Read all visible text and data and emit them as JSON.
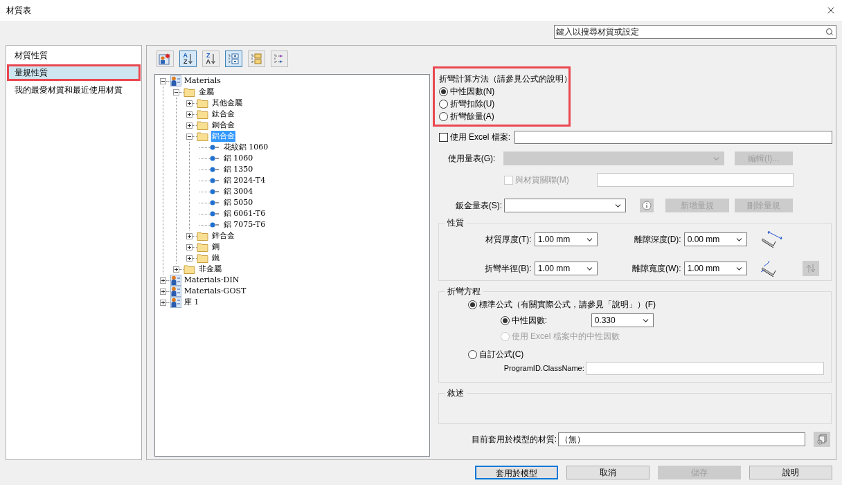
{
  "window": {
    "title": "材質表"
  },
  "search": {
    "placeholder": "鍵入以搜尋材質或設定"
  },
  "nav": {
    "items": [
      {
        "label": "材質性質",
        "selected": false,
        "annotated": false
      },
      {
        "label": "量規性質",
        "selected": true,
        "annotated": true
      },
      {
        "label": "我的最愛材質和最近使用材質",
        "selected": false,
        "annotated": false
      }
    ]
  },
  "toolbar": {
    "buttons": [
      {
        "kind": "new",
        "pressed": false
      },
      {
        "kind": "sort",
        "letters": [
          "A",
          "Z"
        ],
        "pressed": true
      },
      {
        "kind": "sort",
        "letters": [
          "Z",
          "A"
        ],
        "pressed": false
      },
      {
        "kind": "tree",
        "pressed": true
      },
      {
        "kind": "folders",
        "pressed": false
      },
      {
        "kind": "list",
        "pressed": false
      }
    ]
  },
  "tree": [
    {
      "label": "Materials",
      "kind": "library",
      "expanded": true,
      "selected": false,
      "children": [
        {
          "label": "金屬",
          "kind": "folder",
          "expanded": true,
          "selected": false,
          "children": [
            {
              "label": "其他金屬",
              "kind": "folder",
              "expanded": false,
              "selected": false
            },
            {
              "label": "鈦合金",
              "kind": "folder",
              "expanded": false,
              "selected": false
            },
            {
              "label": "銅合金",
              "kind": "folder",
              "expanded": false,
              "selected": false
            },
            {
              "label": "鋁合金",
              "kind": "folder",
              "expanded": true,
              "selected": true,
              "children": [
                {
                  "label": "花紋鋁 1060",
                  "kind": "material",
                  "selected": false
                },
                {
                  "label": "鋁 1060",
                  "kind": "material",
                  "selected": false
                },
                {
                  "label": "鋁 1350",
                  "kind": "material",
                  "selected": false
                },
                {
                  "label": "鋁 2024-T4",
                  "kind": "material",
                  "selected": false
                },
                {
                  "label": "鋁 3004",
                  "kind": "material",
                  "selected": false
                },
                {
                  "label": "鋁 5050",
                  "kind": "material",
                  "selected": false
                },
                {
                  "label": "鋁 6061-T6",
                  "kind": "material",
                  "selected": false
                },
                {
                  "label": "鋁 7075-T6",
                  "kind": "material",
                  "selected": false
                }
              ]
            },
            {
              "label": "鋅合金",
              "kind": "folder",
              "expanded": false,
              "selected": false
            },
            {
              "label": "鋼",
              "kind": "folder",
              "expanded": false,
              "selected": false
            },
            {
              "label": "鐵",
              "kind": "folder",
              "expanded": false,
              "selected": false
            }
          ]
        },
        {
          "label": "非金屬",
          "kind": "folder",
          "expanded": false,
          "selected": false
        }
      ]
    },
    {
      "label": "Materials-DIN",
      "kind": "library",
      "expanded": false,
      "selected": false
    },
    {
      "label": "Materials-GOST",
      "kind": "library",
      "expanded": false,
      "selected": false
    },
    {
      "label": "庫 1",
      "kind": "library",
      "expanded": false,
      "selected": false
    }
  ],
  "bend_method": {
    "title": "折彎計算方法（請參見公式的說明）",
    "annotated": true,
    "options": [
      {
        "label": "中性因數(N)",
        "selected": true
      },
      {
        "label": "折彎扣除(U)",
        "selected": false
      },
      {
        "label": "折彎餘量(A)",
        "selected": false
      }
    ]
  },
  "excel": {
    "label": "使用 Excel 檔案:",
    "checked": false
  },
  "gauge_table": {
    "label": "使用量表(G):",
    "disabled": true,
    "button": {
      "label": "編輯(I)...",
      "disabled": true
    }
  },
  "link_material": {
    "label": "與材質關聯(M)",
    "checked": false,
    "disabled": true
  },
  "sheet_gauge": {
    "label": "鈑金量表(S):",
    "buttons": [
      {
        "label": "新增量規",
        "disabled": true
      },
      {
        "label": "刪除量規",
        "disabled": true
      }
    ]
  },
  "properties": {
    "title": "性質",
    "fields": [
      {
        "label": "材質厚度(T):",
        "value": "1.00 mm"
      },
      {
        "label": "離隙深度(D):",
        "value": "0.00 mm"
      },
      {
        "label": "折彎半徑(B):",
        "value": "1.00 mm"
      },
      {
        "label": "離隙寬度(W):",
        "value": "1.00 mm"
      }
    ]
  },
  "bend_equation": {
    "title": "折彎方程",
    "standard": {
      "label": "標準公式（有關實際公式，請參見「說明」）(F)",
      "selected": true
    },
    "neutral_factor": {
      "label": "中性因數:",
      "selected": true,
      "value": "0.330"
    },
    "excel_factor": {
      "label": "使用 Excel 檔案中的中性因數",
      "selected": false,
      "disabled": true
    },
    "custom": {
      "label": "自訂公式(C)",
      "selected": false
    },
    "class_name": {
      "label": "ProgramID.ClassName:"
    }
  },
  "description": {
    "title": "敘述"
  },
  "current_material": {
    "label": "目前套用於模型的材質:",
    "value": "（無）"
  },
  "buttons": [
    {
      "label": "套用於模型",
      "default": true,
      "disabled": false
    },
    {
      "label": "取消",
      "default": false,
      "disabled": false
    },
    {
      "label": "儲存",
      "default": false,
      "disabled": true
    },
    {
      "label": "說明",
      "default": false,
      "disabled": false
    }
  ]
}
